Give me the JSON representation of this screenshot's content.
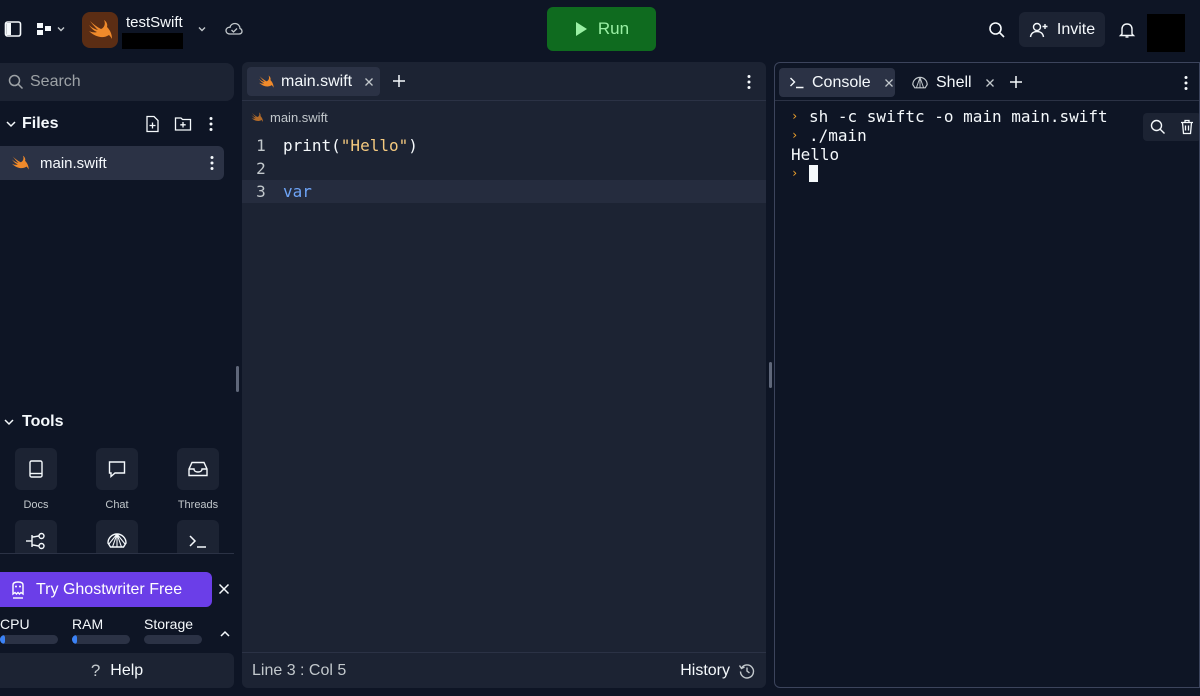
{
  "topbar": {
    "app_name": "testSwift",
    "run_label": "Run",
    "invite_label": "Invite"
  },
  "sidebar": {
    "search_placeholder": "Search",
    "files_title": "Files",
    "files": [
      {
        "name": "main.swift"
      }
    ],
    "tools_title": "Tools",
    "tools": [
      {
        "label": "Docs",
        "icon": "book-icon"
      },
      {
        "label": "Chat",
        "icon": "chat-bubble-icon"
      },
      {
        "label": "Threads",
        "icon": "inbox-icon"
      },
      {
        "label": "",
        "icon": "git-branch-icon"
      },
      {
        "label": "",
        "icon": "shell-icon"
      },
      {
        "label": "",
        "icon": "terminal-icon"
      }
    ],
    "ghostwriter_label": "Try Ghostwriter Free",
    "resources": [
      {
        "label": "CPU",
        "usage": 0.02
      },
      {
        "label": "RAM",
        "usage": 0.08
      },
      {
        "label": "Storage",
        "usage": 0
      }
    ],
    "help_label": "Help"
  },
  "editor": {
    "tab_label": "main.swift",
    "breadcrumb": "main.swift",
    "lines": [
      {
        "num": "1",
        "text": "print(\"Hello\")"
      },
      {
        "num": "2",
        "text": ""
      },
      {
        "num": "3",
        "text": "var"
      }
    ],
    "status_position": "Line 3 : Col 5",
    "history_label": "History"
  },
  "console": {
    "tabs": [
      {
        "label": "Console",
        "icon": "terminal-icon"
      },
      {
        "label": "Shell",
        "icon": "shell-icon"
      }
    ],
    "output": [
      {
        "prompt": true,
        "text": "sh -c swiftc -o main main.swift"
      },
      {
        "prompt": true,
        "text": "./main"
      },
      {
        "prompt": false,
        "text": "Hello"
      }
    ]
  },
  "colors": {
    "background": "#0e1525",
    "panel": "#1c2333",
    "run_button": "#0f6b1f",
    "ghostwriter": "#6b3ee8",
    "keyword": "#6ea4f7",
    "string": "#f4c97f",
    "prompt": "#f0a22b"
  }
}
